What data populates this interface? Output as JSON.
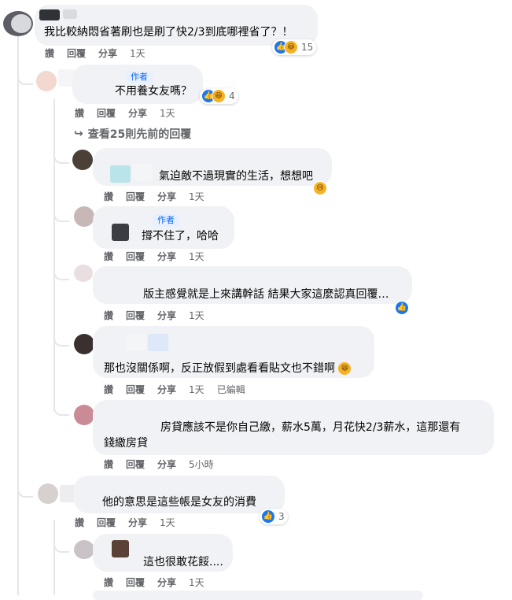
{
  "comments": [
    {
      "text": "我比較納悶省著刷也是刷了快2/3到底哪裡省了？！",
      "reaction_count": "15",
      "actions": {
        "like": "讚",
        "reply": "回覆",
        "share": "分享",
        "time": "1天"
      }
    },
    {
      "badge": "作者",
      "text": "不用養女友嗎？",
      "reaction_count": "4",
      "actions": {
        "like": "讚",
        "reply": "回覆",
        "share": "分享",
        "time": "1天"
      }
    },
    {
      "text": "氣迫敵不過現實的生活，想想吧",
      "actions": {
        "like": "讚",
        "reply": "回覆",
        "share": "分享",
        "time": "1天"
      }
    },
    {
      "badge": "作者",
      "text": "撐不住了，哈哈",
      "actions": {
        "like": "讚",
        "reply": "回覆",
        "share": "分享",
        "time": "1天"
      }
    },
    {
      "text": "版主感覺就是上來講幹話 結果大家這麼認真回覆…",
      "actions": {
        "like": "讚",
        "reply": "回覆",
        "share": "分享",
        "time": "1天"
      }
    },
    {
      "text": "那也沒關係啊，反正放假到處看看貼文也不錯啊",
      "actions": {
        "like": "讚",
        "reply": "回覆",
        "share": "分享",
        "time": "1天",
        "edited": "已編輯"
      }
    },
    {
      "text_line1": "房貸應該不是你自己繳，薪水5萬，月花快2/3薪水，這那還有",
      "text_line2": "錢繳房貸",
      "actions": {
        "like": "讚",
        "reply": "回覆",
        "share": "分享",
        "time": "5小時"
      }
    },
    {
      "text": "他的意思是這些帳是女友的消費",
      "reaction_count": "3",
      "actions": {
        "like": "讚",
        "reply": "回覆",
        "share": "分享",
        "time": "1天"
      }
    },
    {
      "text": "這也很敢花餒....",
      "actions": {
        "like": "讚",
        "reply": "回覆",
        "share": "分享",
        "time": "1天"
      }
    }
  ],
  "more_replies": "查看25則先前的回覆",
  "icons": {
    "like": "like-reaction-icon",
    "haha": "haha-reaction-icon",
    "sad": "sad-reaction-icon",
    "reply_arrow": "reply-arrow-icon",
    "laugh_emoji": "laughing-emoji-icon"
  },
  "colors": {
    "bubble": "#f0f2f5",
    "like_blue": "#1877f2",
    "author_blue": "#0866ff",
    "meta_gray": "#65676b"
  }
}
